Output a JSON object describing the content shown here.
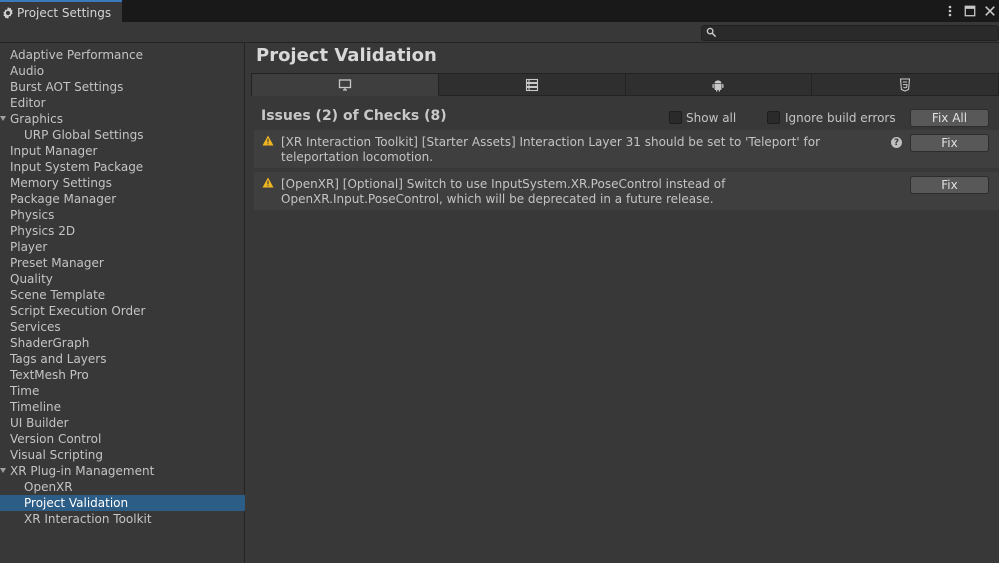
{
  "window": {
    "tab_title": "Project Settings",
    "icons": [
      "gear-icon",
      "kebab-menu-icon",
      "maximize-icon",
      "close-icon"
    ]
  },
  "search": {
    "placeholder": "",
    "icon": "search-icon"
  },
  "sidebar": {
    "items": [
      {
        "label": "Adaptive Performance",
        "child": false
      },
      {
        "label": "Audio",
        "child": false
      },
      {
        "label": "Burst AOT Settings",
        "child": false
      },
      {
        "label": "Editor",
        "child": false
      },
      {
        "label": "Graphics",
        "child": false,
        "expanded": true
      },
      {
        "label": "URP Global Settings",
        "child": true
      },
      {
        "label": "Input Manager",
        "child": false
      },
      {
        "label": "Input System Package",
        "child": false
      },
      {
        "label": "Memory Settings",
        "child": false
      },
      {
        "label": "Package Manager",
        "child": false
      },
      {
        "label": "Physics",
        "child": false
      },
      {
        "label": "Physics 2D",
        "child": false
      },
      {
        "label": "Player",
        "child": false
      },
      {
        "label": "Preset Manager",
        "child": false
      },
      {
        "label": "Quality",
        "child": false
      },
      {
        "label": "Scene Template",
        "child": false
      },
      {
        "label": "Script Execution Order",
        "child": false
      },
      {
        "label": "Services",
        "child": false
      },
      {
        "label": "ShaderGraph",
        "child": false
      },
      {
        "label": "Tags and Layers",
        "child": false
      },
      {
        "label": "TextMesh Pro",
        "child": false
      },
      {
        "label": "Time",
        "child": false
      },
      {
        "label": "Timeline",
        "child": false
      },
      {
        "label": "UI Builder",
        "child": false
      },
      {
        "label": "Version Control",
        "child": false
      },
      {
        "label": "Visual Scripting",
        "child": false
      },
      {
        "label": "XR Plug-in Management",
        "child": false,
        "expanded": true
      },
      {
        "label": "OpenXR",
        "child": true
      },
      {
        "label": "Project Validation",
        "child": true,
        "selected": true
      },
      {
        "label": "XR Interaction Toolkit",
        "child": true
      }
    ]
  },
  "main": {
    "title": "Project Validation",
    "platform_tabs": [
      {
        "icon": "monitor-icon",
        "selected": true
      },
      {
        "icon": "server-icon",
        "selected": false
      },
      {
        "icon": "android-icon",
        "selected": false
      },
      {
        "icon": "html5-icon",
        "selected": false
      }
    ],
    "issues_header": "Issues (2) of Checks (8)",
    "show_all_label": "Show all",
    "show_all_checked": false,
    "ignore_build_errors_label": "Ignore build errors",
    "ignore_build_errors_checked": false,
    "fix_all_label": "Fix All",
    "issues": [
      {
        "icon": "warning-icon",
        "message": "[XR Interaction Toolkit] [Starter Assets] Interaction Layer 31 should be set to 'Teleport' for teleportation locomotion.",
        "has_help": true,
        "fix_label": "Fix"
      },
      {
        "icon": "warning-icon",
        "message": "[OpenXR] [Optional] Switch to use InputSystem.XR.PoseControl instead of OpenXR.Input.PoseControl, which will be deprecated in a future release.",
        "has_help": false,
        "fix_label": "Fix"
      }
    ]
  }
}
